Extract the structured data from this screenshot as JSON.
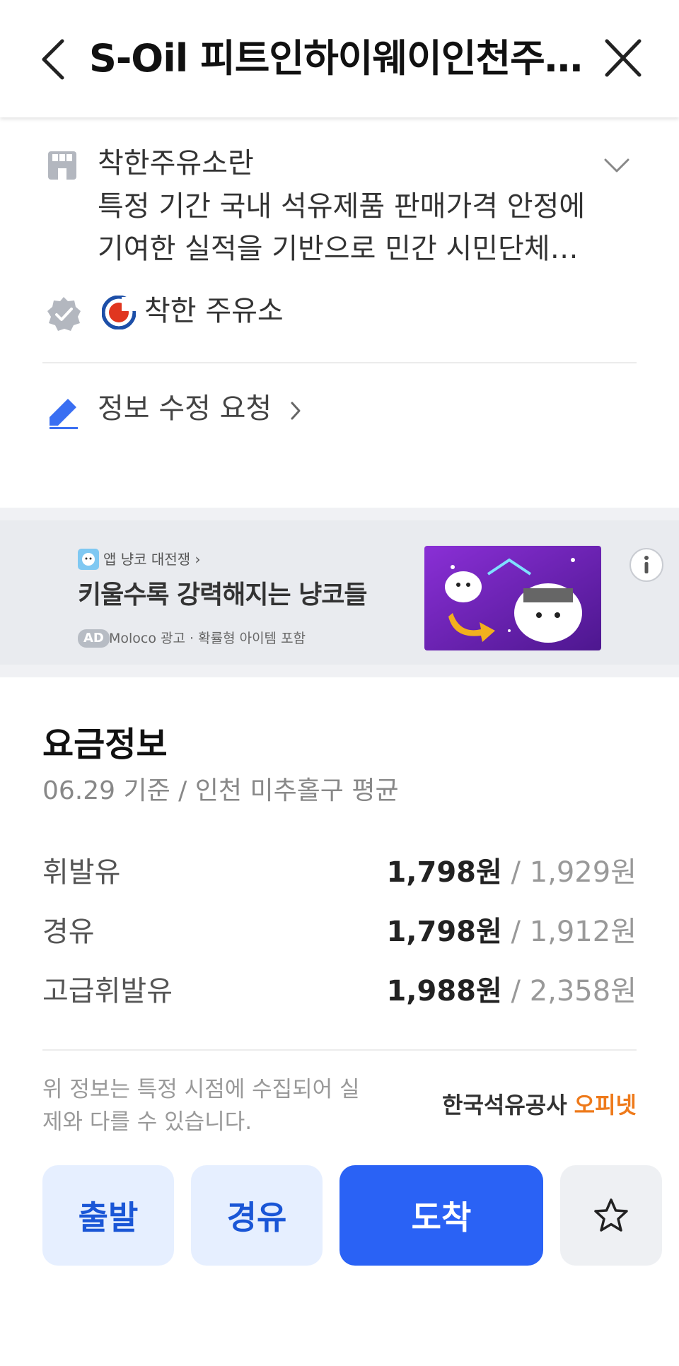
{
  "header": {
    "title": "S-Oil 피트인하이웨이인천주유소",
    "back_icon": "chevron-left-icon",
    "close_icon": "close-icon"
  },
  "intro": {
    "icon": "store-icon",
    "title": "착한주유소란",
    "body": "특정 기간 국내 석유제품 판매가격 안정에 기여한 실적을 기반으로 민간 시민단체와 지자체가 선정한 주유소입니다.",
    "expand_icon": "chevron-down-icon"
  },
  "certification": {
    "icon": "verified-badge-icon",
    "logo_icon": "good-station-logo-icon",
    "label": "착한 주유소"
  },
  "edit": {
    "icon": "pencil-icon",
    "label": "정보 수정 요청"
  },
  "ad": {
    "app_label": "앱 냥코 대전쟁 ›",
    "headline": "키울수록 강력해지는 냥코들",
    "tag": "AD",
    "sponsor": "Moloco 광고 · 확률형 아이템 포함",
    "info_icon": "info-icon",
    "colors": {
      "image_bg": "#6a24b8",
      "arrow": "#f2b01e"
    }
  },
  "price": {
    "title": "요금정보",
    "subtitle": "06.29 기준 / 인천 미추홀구 평균",
    "rows": [
      {
        "name": "휘발유",
        "price": "1,798원",
        "sep": " / ",
        "avg": "1,929원"
      },
      {
        "name": "경유",
        "price": "1,798원",
        "sep": " / ",
        "avg": "1,912원"
      },
      {
        "name": "고급휘발유",
        "price": "1,988원",
        "sep": " / ",
        "avg": "2,358원"
      }
    ],
    "notice": "위 정보는 특정 시점에 수집되어 실제와 다를 수 있습니다.",
    "source_org": "한국석유공사",
    "source_brand": "오피넷"
  },
  "actions": {
    "depart": "출발",
    "via": "경유",
    "arrive": "도착",
    "favorite_icon": "star-icon"
  },
  "colors": {
    "accent": "#2a62f5",
    "accent_light": "#e6efff",
    "opinet": "#ee7a1b"
  }
}
